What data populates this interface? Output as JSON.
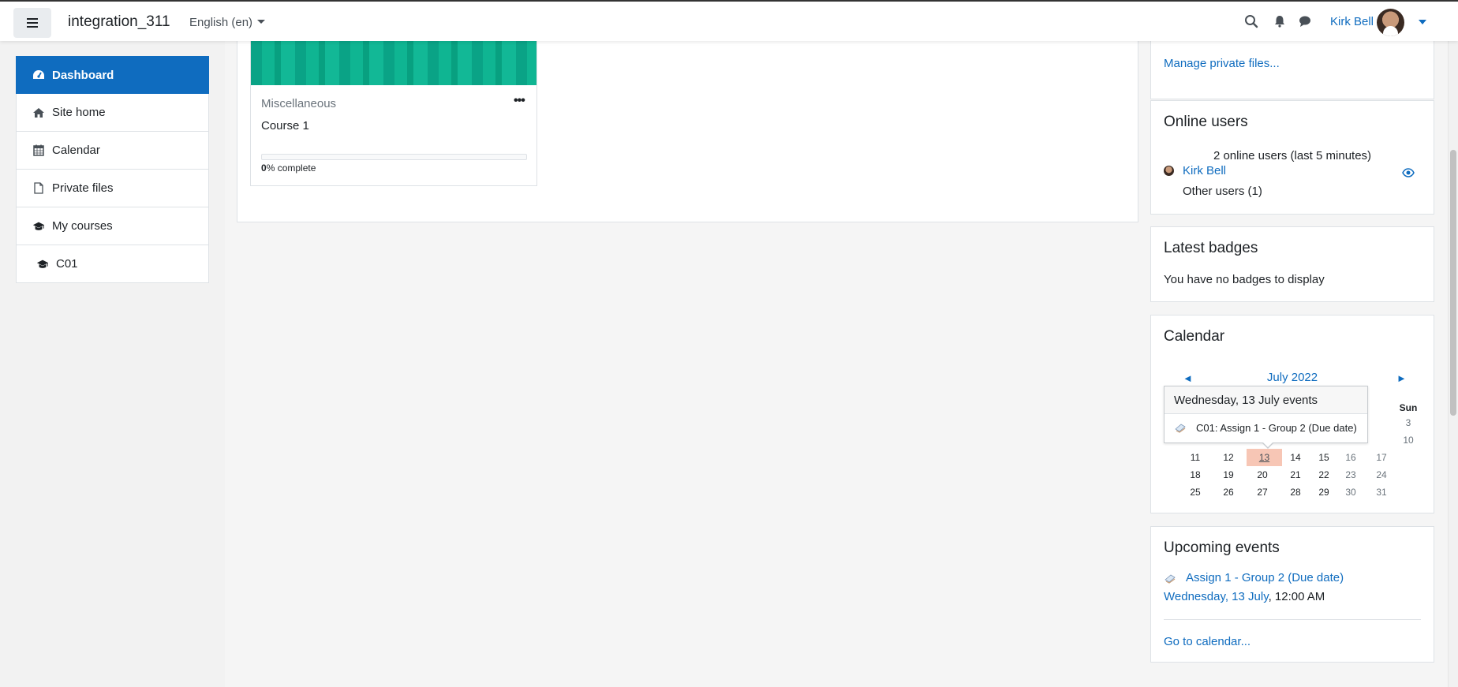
{
  "navbar": {
    "site_name": "integration_311",
    "language": "English (en)",
    "user_name": "Kirk Bell"
  },
  "nav": {
    "items": [
      {
        "label": "Dashboard",
        "icon": "dashboard-icon"
      },
      {
        "label": "Site home",
        "icon": "home-icon"
      },
      {
        "label": "Calendar",
        "icon": "calendar-icon"
      },
      {
        "label": "Private files",
        "icon": "file-icon"
      },
      {
        "label": "My courses",
        "icon": "graduation-cap-icon"
      },
      {
        "label": "C01",
        "icon": "graduation-cap-icon"
      }
    ]
  },
  "course_card": {
    "category": "Miscellaneous",
    "name": "Course 1",
    "progress_value": "0",
    "progress_suffix": "% complete",
    "progress_fraction": 0
  },
  "private_files": {
    "link": "Manage private files..."
  },
  "online_users": {
    "title": "Online users",
    "count_text": "2 online users (last 5 minutes)",
    "user": "Kirk Bell",
    "other": "Other users (1)"
  },
  "badges": {
    "title": "Latest badges",
    "empty": "You have no badges to display"
  },
  "calendar": {
    "title": "Calendar",
    "month": "July 2022",
    "prev": "◄",
    "next": "►",
    "head_sun": "Sun",
    "rows": [
      [
        "",
        "",
        "",
        "",
        "",
        "",
        "3"
      ],
      [
        "",
        "",
        "",
        "",
        "",
        "",
        "10"
      ],
      [
        "11",
        "12",
        "13",
        "14",
        "15",
        "16",
        "17"
      ],
      [
        "18",
        "19",
        "20",
        "21",
        "22",
        "23",
        "24"
      ],
      [
        "25",
        "26",
        "27",
        "28",
        "29",
        "30",
        "31"
      ]
    ],
    "today": "13",
    "popover": {
      "title": "Wednesday, 13 July events",
      "event": "C01: Assign 1 - Group 2 (Due date)"
    }
  },
  "upcoming": {
    "title": "Upcoming events",
    "event": "Assign 1 - Group 2 (Due date)",
    "date_link": "Wednesday, 13 July",
    "time": ", 12:00 AM",
    "goto": "Go to calendar..."
  }
}
